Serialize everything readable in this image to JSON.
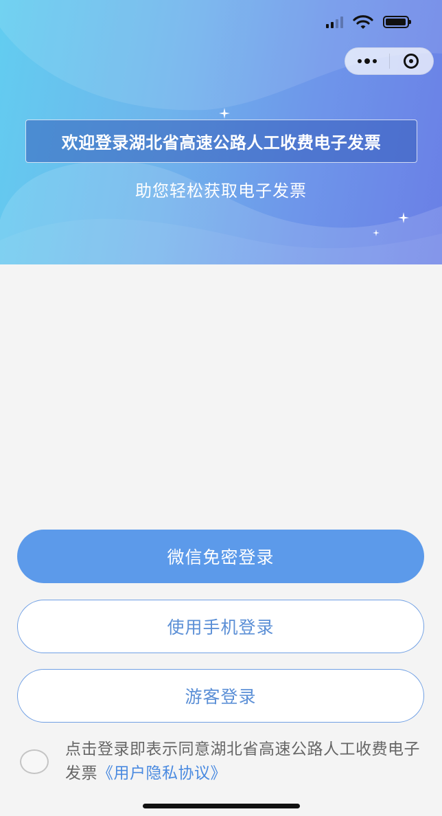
{
  "banner": {
    "title": "欢迎登录湖北省高速公路人工收费电子发票",
    "subtitle": "助您轻松获取电子发票"
  },
  "status_bar": {
    "icons": [
      "signal-icon",
      "wifi-icon",
      "battery-icon"
    ]
  },
  "capsule": {
    "more_icon": "more-dots-icon",
    "close_icon": "close-circle-icon"
  },
  "buttons": {
    "wechat_login": "微信免密登录",
    "phone_login": "使用手机登录",
    "guest_login": "游客登录"
  },
  "agreement": {
    "text": "点击登录即表示同意湖北省高速公路人工收费电子发票",
    "link": "《用户隐私协议》"
  },
  "colors": {
    "banner_start": "#62cdf0",
    "banner_end": "#6a7fe6",
    "primary": "#5c9aea",
    "outline_text": "#5b8fd6",
    "link": "#4a8ae0",
    "page_background": "#f4f4f4"
  }
}
